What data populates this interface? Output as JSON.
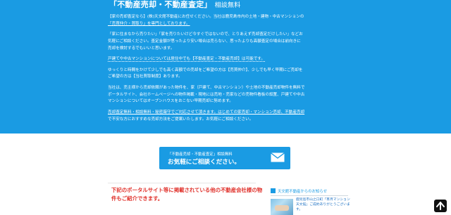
{
  "hero": {
    "title_main": "「不動産売却・不動産査定」",
    "title_sub": "相談無料",
    "p1": [
      "【家の売却査定なら】(株)天文館不動産にお任せください。当社は鹿児島市内の土地・建物・中古マンションの",
      "「売買仲介・買取り」を専門としております。"
    ],
    "p2": [
      "「家に住まなから売りたい」「家を売りたいけど今すぐではないので、とりあえず売却査定だけしたい」などお",
      "気軽にご相談ください。査定金額が思ったより安い場合は売らない、思ったよりも高額査定の場合は前向きに",
      "売却を検討するでもいいと思います。"
    ],
    "p3": "戸建てや中古マンションについては居住中でも【不動産査定・不動産売却】は可能です。",
    "p4": [
      "ゆっくりと時間をかけて少しでも高く高額での売却をご希望の方は【売買仲介】、少しでも早く早期にご売却を",
      "ご希望の方は【当社買取制度】あります。"
    ],
    "p5": [
      "当社は、売主様から売却依頼があった物件を、家（戸建て、中古マンション）や土地の不動産売却物件を無料で",
      "ポータルサイト、会社ホームページへの物件掲載・現地には売地・売家などの売物件看板の設置、戸建てや中古",
      "マンションについてはオープンハウスをおこない早期売却に努めます。"
    ],
    "p6": [
      "売却査定無料・相談無料・秘密厳守でご対応させて頂きます。はじめての家売却・マンション売却、不動産売却",
      "で不安な方におすすめな売却方法をご提案いたします。お気軽にご相談ください。"
    ]
  },
  "cta": {
    "small_label": "「不動産売却・不動産査定」相談無料",
    "big_label": "お気軽にご相談ください。",
    "icon": "mail-icon"
  },
  "portal_note": "下記のポータルサイト等に掲載されている他の不動産会社様の物件もご紹介できます。",
  "news": {
    "heading": "天文館不動産からのお知らせ",
    "item_text": "鹿児島市山之口町「草月マンション天文館」ご成約ありがとうございます。"
  },
  "to_top": {
    "icon": "arrow-up-icon"
  }
}
